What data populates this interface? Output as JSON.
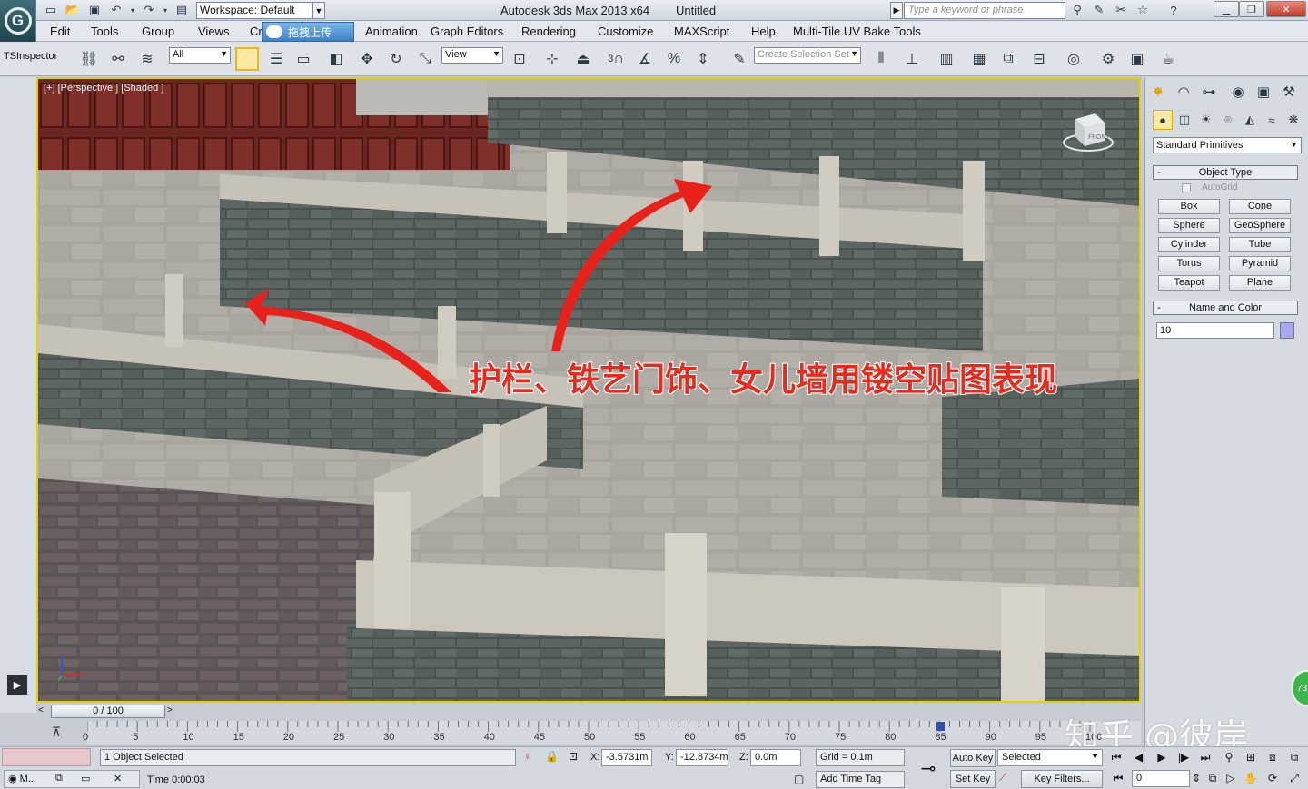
{
  "titlebar": {
    "workspace": "Workspace: Default",
    "app_title": "Autodesk 3ds Max  2013 x64",
    "doc_title": "Untitled",
    "search_placeholder": "Type a keyword or phrase"
  },
  "menu": {
    "items": [
      "Edit",
      "Tools",
      "Group",
      "Views",
      "Cr",
      "Animation",
      "Graph Editors",
      "Rendering",
      "Customize",
      "MAXScript",
      "Help",
      "Multi-Tile UV Bake Tools"
    ],
    "upload_label": "拖拽上传"
  },
  "toolbar": {
    "tsinspector": "TSInspector",
    "selection_filter": "All",
    "ref_coord": "View",
    "named_selection": "Create Selection Set",
    "snap_label": "3"
  },
  "viewport": {
    "label": "[+] [Perspective ] [Shaded ]",
    "caption": "护栏、铁艺门饰、女儿墙用镂空贴图表现",
    "viewcube_label": "FRONT"
  },
  "command_panel": {
    "primitive_type": "Standard Primitives",
    "object_type_title": "Object Type",
    "autogrid": "AutoGrid",
    "buttons": [
      "Box",
      "Cone",
      "Sphere",
      "GeoSphere",
      "Cylinder",
      "Tube",
      "Torus",
      "Pyramid",
      "Teapot",
      "Plane"
    ],
    "name_color_title": "Name and Color",
    "name_value": "10",
    "swatch_color": "#a8a6f0"
  },
  "timeline": {
    "slider": "0 / 100",
    "ticks": [
      "0",
      "5",
      "10",
      "15",
      "20",
      "25",
      "30",
      "35",
      "40",
      "45",
      "50",
      "55",
      "60",
      "65",
      "70",
      "75",
      "80",
      "85",
      "90",
      "95",
      "100"
    ]
  },
  "statusbar": {
    "selection_status": "1 Object Selected",
    "x_label": "X:",
    "x_value": "-3.5731m",
    "y_label": "Y:",
    "y_value": "-12.8734m",
    "z_label": "Z:",
    "z_value": "0.0m",
    "grid": "Grid = 0.1m",
    "add_time_tag": "Add Time Tag",
    "time": "Time  0:00:03",
    "auto_key": "Auto Key",
    "set_key": "Set Key",
    "key_mode": "Selected",
    "key_filters": "Key Filters...",
    "frame": "0",
    "maxscript_tab": "M..."
  },
  "watermark": "知乎 @彼岸",
  "badge": "73"
}
